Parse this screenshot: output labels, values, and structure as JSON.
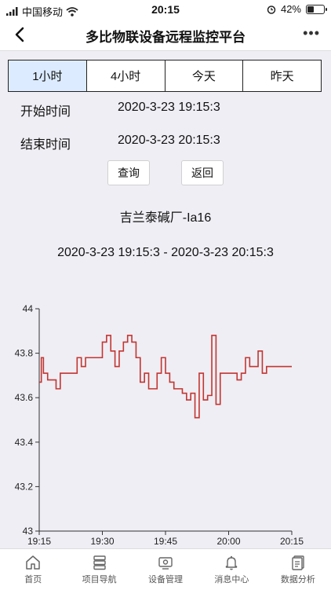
{
  "status": {
    "carrier": "中国移动",
    "time": "20:15",
    "battery": "42%",
    "battery_level": 0.42
  },
  "header": {
    "title": "多比物联设备远程监控平台"
  },
  "range_tabs": [
    {
      "label": "1小时",
      "active": true
    },
    {
      "label": "4小时",
      "active": false
    },
    {
      "label": "今天",
      "active": false
    },
    {
      "label": "昨天",
      "active": false
    }
  ],
  "query": {
    "start_label": "开始时间",
    "start_value": "2020-3-23 19:15:3",
    "end_label": "结束时间",
    "end_value": "2020-3-23 20:15:3",
    "search_label": "查询",
    "back_label": "返回"
  },
  "device_name": "吉兰泰碱厂-Ia16",
  "period_text": "2020-3-23 19:15:3 - 2020-3-23 20:15:3",
  "chart_data": {
    "type": "line",
    "step": true,
    "color": "#c23531",
    "ylim": [
      43,
      44
    ],
    "yticks": [
      43,
      43.2,
      43.4,
      43.6,
      43.8,
      44
    ],
    "ytick_labels": [
      "43",
      "43.2",
      "43.4",
      "43.6",
      "43.8",
      "44"
    ],
    "xlim": [
      0,
      60
    ],
    "xticks": [
      0,
      15,
      30,
      45,
      60
    ],
    "xtick_labels": [
      "19:15",
      "19:30",
      "19:45",
      "20:00",
      "20:15"
    ],
    "grid": false,
    "series": [
      {
        "x": [
          0,
          0.5,
          1,
          2,
          3,
          4,
          5,
          6,
          7,
          8,
          9,
          10,
          11,
          12,
          13,
          14,
          15,
          16,
          17,
          18,
          19,
          20,
          21,
          22,
          23,
          24,
          25,
          26,
          27,
          28,
          29,
          30,
          31,
          32,
          33,
          34,
          35,
          36,
          37,
          38,
          39,
          40,
          41,
          42,
          43,
          44,
          45,
          46,
          47,
          48,
          49,
          50,
          51,
          52,
          53,
          54,
          55,
          56,
          57,
          58,
          59,
          60
        ],
        "y": [
          43.67,
          43.78,
          43.71,
          43.68,
          43.68,
          43.64,
          43.71,
          43.71,
          43.71,
          43.71,
          43.78,
          43.74,
          43.78,
          43.78,
          43.78,
          43.78,
          43.85,
          43.88,
          43.81,
          43.74,
          43.81,
          43.85,
          43.88,
          43.85,
          43.78,
          43.67,
          43.71,
          43.64,
          43.64,
          43.71,
          43.78,
          43.71,
          43.67,
          43.64,
          43.64,
          43.62,
          43.59,
          43.62,
          43.51,
          43.71,
          43.59,
          43.61,
          43.88,
          43.57,
          43.71,
          43.71,
          43.71,
          43.71,
          43.68,
          43.71,
          43.78,
          43.74,
          43.74,
          43.81,
          43.71,
          43.74,
          43.74,
          43.74,
          43.74,
          43.74,
          43.74,
          43.74
        ]
      }
    ]
  },
  "tabbar": [
    {
      "label": "首页",
      "icon": "home-icon"
    },
    {
      "label": "项目导航",
      "icon": "server-icon"
    },
    {
      "label": "设备管理",
      "icon": "device-icon"
    },
    {
      "label": "消息中心",
      "icon": "bell-icon"
    },
    {
      "label": "数据分析",
      "icon": "document-icon"
    }
  ]
}
